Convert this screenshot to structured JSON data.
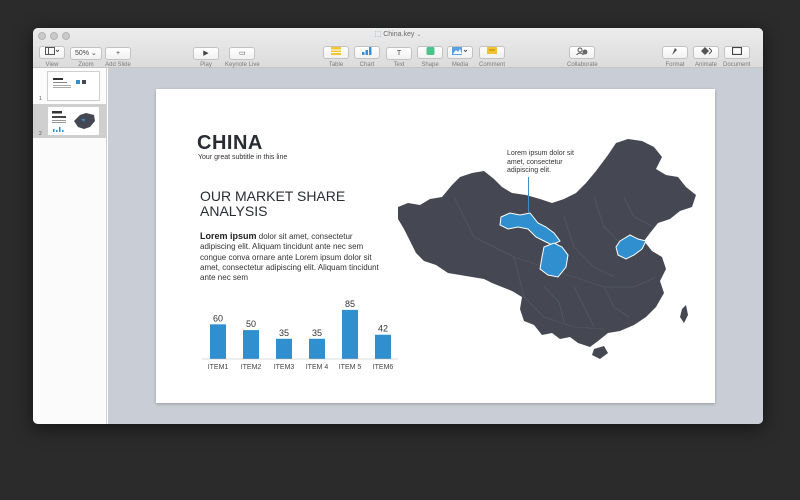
{
  "window": {
    "title": "China.key",
    "doc_icon": "keynote-doc-icon"
  },
  "toolbar": {
    "view": {
      "label": "View",
      "icon": "sidebar-view-icon"
    },
    "zoom": {
      "label": "Zoom",
      "value": "50%"
    },
    "add_slide": {
      "label": "Add Slide",
      "glyph": "+"
    },
    "play": {
      "label": "Play",
      "glyph": "▶"
    },
    "keynote_live": {
      "label": "Keynote Live",
      "glyph": "▭"
    },
    "table": {
      "label": "Table",
      "color": "#f4c430"
    },
    "chart": {
      "label": "Chart",
      "color": "#3b8fd9"
    },
    "text": {
      "label": "Text",
      "glyph": "T"
    },
    "shape": {
      "label": "Shape",
      "color": "#4cc38a"
    },
    "media": {
      "label": "Media",
      "color": "#5aa0e0"
    },
    "comment": {
      "label": "Comment",
      "color": "#f2c12e"
    },
    "collaborate": {
      "label": "Collaborate"
    },
    "format": {
      "label": "Format"
    },
    "animate": {
      "label": "Animate"
    },
    "document": {
      "label": "Document"
    }
  },
  "navigator": {
    "slides": [
      {
        "number": "1"
      },
      {
        "number": "2"
      }
    ]
  },
  "slide": {
    "title": "CHINA",
    "subtitle": "Your great subtitle in this line",
    "heading": "OUR MARKET SHARE ANALYSIS",
    "body_lead": "Lorem ipsum",
    "body_text": " dolor sit amet, consectetur adipiscing elit. Aliquam tincidunt ante nec sem congue conva ornare ante Lorem ipsum dolor sit amet, consectetur adipiscing elit. Aliquam tincidunt ante nec sem",
    "callout": "Lorem ipsum dolor sit amet, consectetur adipiscing elit.",
    "map_color": "#454852",
    "highlight_color": "#2f8fcf"
  },
  "chart_data": {
    "type": "bar",
    "categories": [
      "ITEM1",
      "ITEM2",
      "ITEM3",
      "ITEM 4",
      "ITEM 5",
      "ITEM6"
    ],
    "values": [
      60,
      50,
      35,
      35,
      85,
      42
    ],
    "ylim": [
      0,
      90
    ],
    "color": "#2f8fcf",
    "grid": false
  }
}
